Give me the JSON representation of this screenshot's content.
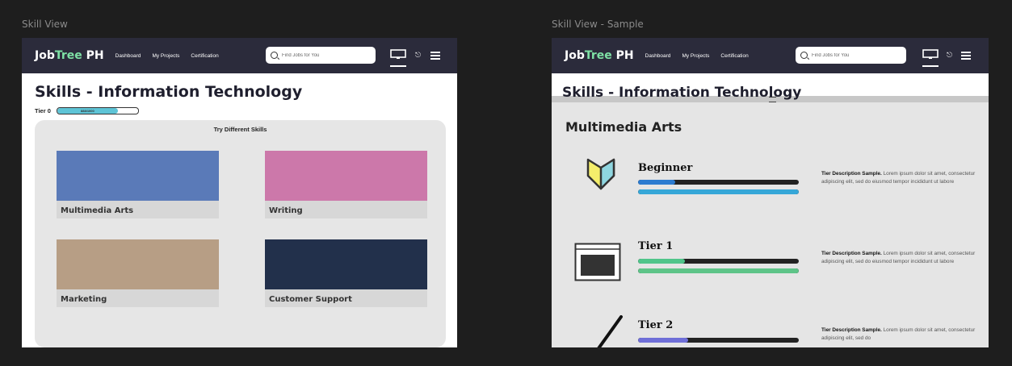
{
  "canvas": {
    "frame1_label": "Skill View",
    "frame2_label": "Skill View - Sample"
  },
  "nav": {
    "logo_prefix": "Job",
    "logo_highlight": "Tree",
    "logo_suffix": " PH",
    "links": [
      "Dashboard",
      "My Projects",
      "Certification"
    ],
    "search_placeholder": "Find Jobs for You",
    "icons": [
      "search-icon",
      "monitor-icon",
      "bell-icon",
      "menu-icon"
    ]
  },
  "skill_view": {
    "title": "Skills - Information Technology",
    "tier_label": "Tier 0",
    "progress_text": "888/1000",
    "progress_fraction": 0.75,
    "panel_title": "Try Different Skills",
    "skills": [
      {
        "label": "Multimedia Arts",
        "color": "#5a7ab8"
      },
      {
        "label": "Writing",
        "color": "#cc78aa"
      },
      {
        "label": "Marketing",
        "color": "#b79e85"
      },
      {
        "label": "Customer Support",
        "color": "#22304b"
      }
    ]
  },
  "sample": {
    "title": "Skills - Information Technology",
    "section_title": "Multimedia Arts",
    "tiers": [
      {
        "name": "Beginner",
        "icon": "shield-icon",
        "bars": [
          {
            "fill": 0.23,
            "color": "#2b7bd0"
          },
          {
            "fill": 1.0,
            "color": "#36a7d8"
          }
        ],
        "desc_bold": "Tier Description Sample.",
        "desc_text": " Lorem ipsum dolor sit amet, consectetur adipiscing elit, sed do eiusmod tempor incididunt ut labore"
      },
      {
        "name": "Tier 1",
        "icon": "browser-window-icon",
        "bars": [
          {
            "fill": 0.29,
            "color": "#4fc58a"
          },
          {
            "fill": 1.0,
            "color": "#5ec488"
          }
        ],
        "desc_bold": "Tier Description Sample.",
        "desc_text": " Lorem ipsum dolor sit amet, consectetur adipiscing elit, sed do eiusmod tempor incididunt ut labore"
      },
      {
        "name": "Tier 2",
        "icon": "pen-icon",
        "bars": [
          {
            "fill": 0.31,
            "color": "#6f6fd8"
          }
        ],
        "desc_bold": "Tier Description Sample.",
        "desc_text": " Lorem ipsum dolor sit amet, consectetur adipiscing elit, sed do"
      }
    ]
  },
  "colors": {
    "nav_bg": "#2b2b3b",
    "logo_accent": "#7ee0a5",
    "canvas_bg": "#1e1e1e",
    "panel_bg": "#e6e6e6",
    "progress_fill": "#5ec4d6"
  }
}
